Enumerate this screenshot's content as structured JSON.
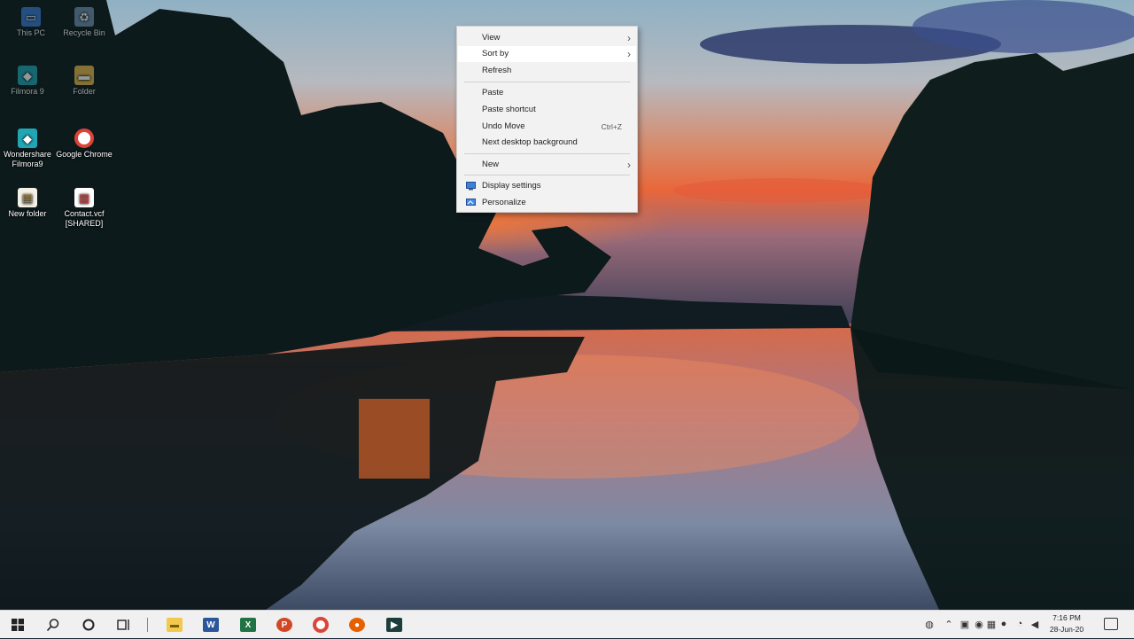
{
  "desktop": {
    "icons": [
      {
        "label": "This PC",
        "icon": "computer-icon"
      },
      {
        "label": "Recycle Bin",
        "icon": "recycle-bin-icon"
      },
      {
        "label": "Filmora 9",
        "icon": "filmora-icon"
      },
      {
        "label": "Folder",
        "icon": "folder-icon"
      },
      {
        "label": "Wondershare Filmora9",
        "icon": "filmora-app-icon"
      },
      {
        "label": "Google Chrome",
        "icon": "chrome-icon"
      },
      {
        "label": "New folder",
        "icon": "file-icon"
      },
      {
        "label": "Contact.vcf [SHARED]",
        "icon": "vcf-file-icon"
      }
    ]
  },
  "context_menu": {
    "items": {
      "view": "View",
      "sort_by": "Sort by",
      "refresh": "Refresh",
      "paste": "Paste",
      "paste_shortcut": "Paste shortcut",
      "undo_move": "Undo Move",
      "undo_shortcut": "Ctrl+Z",
      "next_bg": "Next desktop background",
      "new": "New",
      "display_settings": "Display settings",
      "personalize": "Personalize"
    },
    "hovered": "Sort by"
  },
  "taskbar": {
    "apps": [
      "start-icon",
      "search-icon",
      "cortana-icon",
      "task-view-icon",
      "file-explorer-icon",
      "word-icon",
      "excel-icon",
      "powerpoint-icon",
      "chrome-icon",
      "firefox-icon",
      "filmora-taskbar-icon"
    ],
    "clock": {
      "time": "7:16 PM",
      "date": "28-Jun-20"
    },
    "accent": "#0078d7"
  }
}
